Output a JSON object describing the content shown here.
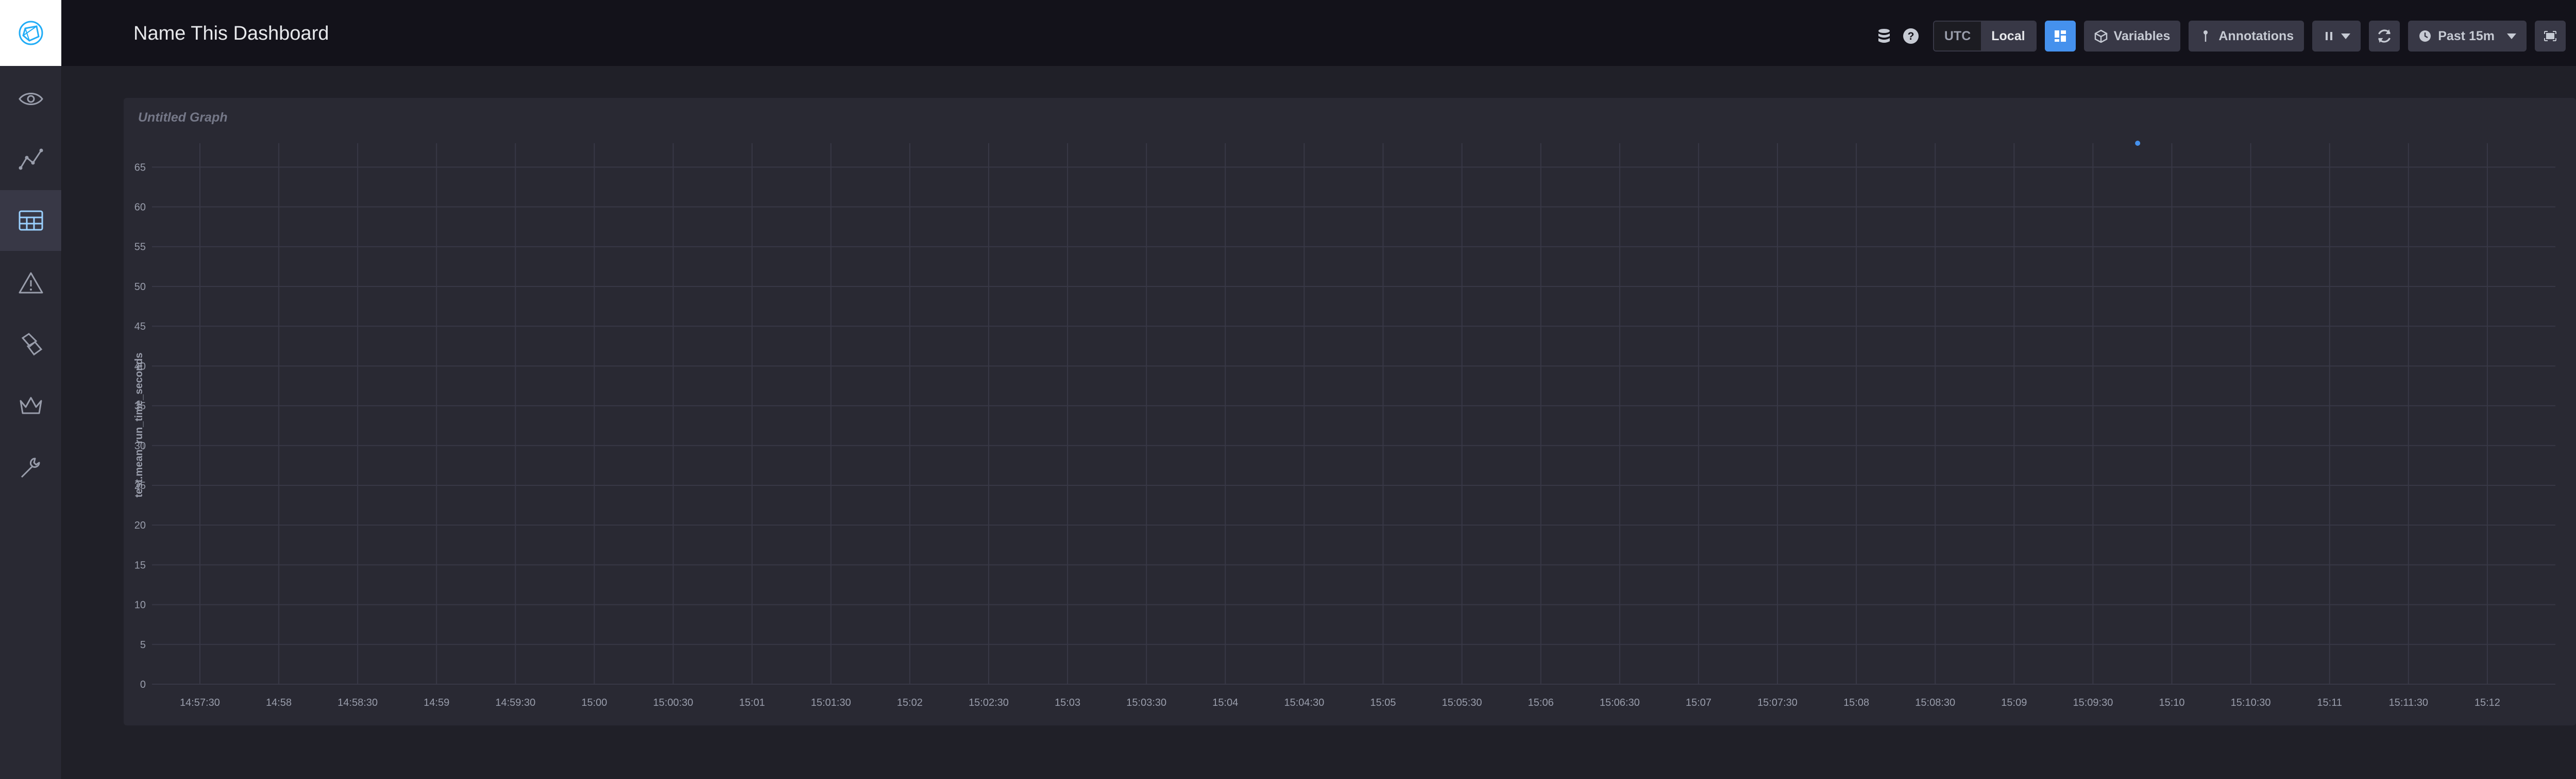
{
  "sidebar": {
    "items": [
      {
        "name": "eye-icon"
      },
      {
        "name": "graph-icon"
      },
      {
        "name": "dashboards-icon",
        "active": true
      },
      {
        "name": "alert-icon"
      },
      {
        "name": "plugs-icon"
      },
      {
        "name": "crown-icon"
      },
      {
        "name": "wrench-icon"
      }
    ]
  },
  "header": {
    "title": "Name This Dashboard",
    "tz_utc": "UTC",
    "tz_local": "Local",
    "tz_selected": "Local",
    "variables_label": "Variables",
    "annotations_label": "Annotations",
    "time_range_label": "Past 15m"
  },
  "panel": {
    "title": "Untitled Graph"
  },
  "chart_data": {
    "type": "scatter",
    "ylabel": "test.mean_run_time_seconds",
    "ylim": [
      0,
      68
    ],
    "yticks": [
      0,
      5,
      10,
      15,
      20,
      25,
      30,
      35,
      40,
      45,
      50,
      55,
      60,
      65
    ],
    "xticks": [
      "14:57:30",
      "14:58",
      "14:58:30",
      "14:59",
      "14:59:30",
      "15:00",
      "15:00:30",
      "15:01",
      "15:01:30",
      "15:02",
      "15:02:30",
      "15:03",
      "15:03:30",
      "15:04",
      "15:04:30",
      "15:05",
      "15:05:30",
      "15:06",
      "15:06:30",
      "15:07",
      "15:07:30",
      "15:08",
      "15:08:30",
      "15:09",
      "15:09:30",
      "15:10",
      "15:10:30",
      "15:11",
      "15:11:30",
      "15:12"
    ],
    "series": [
      {
        "color": "#4591ed",
        "points": [
          {
            "x": "15:09:47",
            "y": 68
          }
        ]
      }
    ],
    "grid": true
  }
}
